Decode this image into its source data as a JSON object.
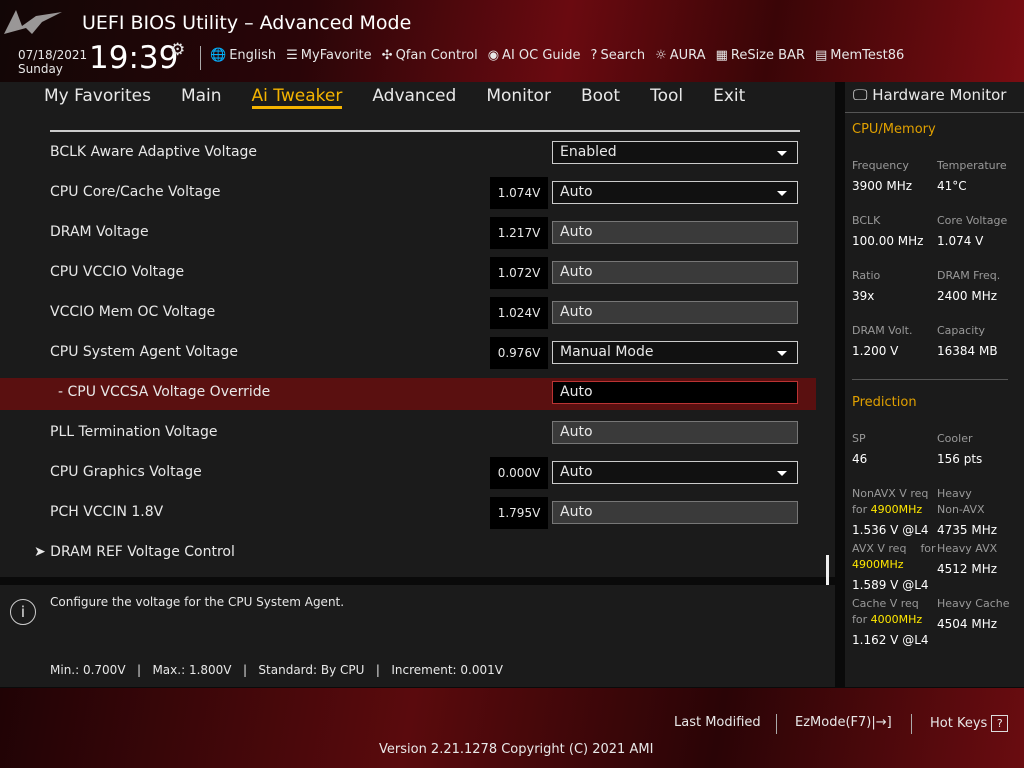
{
  "header": {
    "title": "UEFI BIOS Utility – Advanced Mode",
    "date": "07/18/2021",
    "day": "Sunday",
    "time": "19:39",
    "tools": [
      {
        "icon": "globe-icon",
        "glyph": "🌐",
        "label": "English"
      },
      {
        "icon": "favorite-icon",
        "glyph": "☰",
        "label": "MyFavorite"
      },
      {
        "icon": "fan-icon",
        "glyph": "✣",
        "label": "Qfan Control"
      },
      {
        "icon": "ai-oc-icon",
        "glyph": "◉",
        "label": "AI OC Guide"
      },
      {
        "icon": "help-icon",
        "glyph": "?",
        "label": "Search"
      },
      {
        "icon": "aura-icon",
        "glyph": "☼",
        "label": "AURA"
      },
      {
        "icon": "resize-bar-icon",
        "glyph": "▦",
        "label": "ReSize BAR"
      },
      {
        "icon": "memtest-icon",
        "glyph": "▤",
        "label": "MemTest86"
      }
    ]
  },
  "nav": {
    "tabs": [
      "My Favorites",
      "Main",
      "Ai Tweaker",
      "Advanced",
      "Monitor",
      "Boot",
      "Tool",
      "Exit"
    ],
    "active": "Ai Tweaker"
  },
  "settings": [
    {
      "label": "BCLK Aware Adaptive Voltage",
      "voltage": null,
      "value": "Enabled",
      "type": "dropdown"
    },
    {
      "label": "CPU Core/Cache Voltage",
      "voltage": "1.074V",
      "value": "Auto",
      "type": "dropdown"
    },
    {
      "label": "DRAM Voltage",
      "voltage": "1.217V",
      "value": "Auto",
      "type": "input"
    },
    {
      "label": "CPU VCCIO Voltage",
      "voltage": "1.072V",
      "value": "Auto",
      "type": "input"
    },
    {
      "label": "VCCIO Mem OC Voltage",
      "voltage": "1.024V",
      "value": "Auto",
      "type": "input"
    },
    {
      "label": "CPU System Agent Voltage",
      "voltage": "0.976V",
      "value": "Manual Mode",
      "type": "dropdown"
    },
    {
      "label": "- CPU VCCSA Voltage Override",
      "voltage": null,
      "value": "Auto",
      "type": "selected"
    },
    {
      "label": "PLL Termination Voltage",
      "voltage": null,
      "value": "Auto",
      "type": "input"
    },
    {
      "label": "CPU Graphics Voltage",
      "voltage": "0.000V",
      "value": "Auto",
      "type": "dropdown"
    },
    {
      "label": "PCH VCCIN 1.8V",
      "voltage": "1.795V",
      "value": "Auto",
      "type": "input"
    },
    {
      "label": "➤  DRAM REF Voltage Control",
      "voltage": null,
      "value": null,
      "type": "submenu"
    }
  ],
  "help": {
    "text": "Configure the voltage for the CPU System Agent.",
    "limits": "Min.: 0.700V   |   Max.: 1.800V   |   Standard: By CPU   |   Increment: 0.001V"
  },
  "hardware_monitor": {
    "title": "Hardware Monitor",
    "cpu_memory": {
      "title": "CPU/Memory",
      "items": [
        {
          "k": "Frequency",
          "v": "3900 MHz"
        },
        {
          "k": "Temperature",
          "v": "41°C"
        },
        {
          "k": "BCLK",
          "v": "100.00 MHz"
        },
        {
          "k": "Core Voltage",
          "v": "1.074 V"
        },
        {
          "k": "Ratio",
          "v": "39x"
        },
        {
          "k": "DRAM Freq.",
          "v": "2400 MHz"
        },
        {
          "k": "DRAM Volt.",
          "v": "1.200 V"
        },
        {
          "k": "Capacity",
          "v": "16384 MB"
        }
      ]
    },
    "prediction": {
      "title": "Prediction",
      "sp_label": "SP",
      "sp": "46",
      "cooler_label": "Cooler",
      "cooler": "156 pts",
      "nonavx_req": "NonAVX V req",
      "nonavx_for": "for ",
      "nonavx_freq": "4900MHz",
      "nonavx_v": "1.536 V @L4",
      "heavy_nonavx_label1": "Heavy",
      "heavy_nonavx_label2": "Non-AVX",
      "heavy_nonavx": "4735 MHz",
      "avx_req": "AVX V req",
      "avx_for": "for",
      "avx_freq": "4900MHz",
      "avx_v": "1.589 V @L4",
      "heavy_avx_label": "Heavy AVX",
      "heavy_avx": "4512 MHz",
      "cache_req": "Cache V req",
      "cache_for": "for ",
      "cache_freq": "4000MHz",
      "cache_v": "1.162 V @L4",
      "heavy_cache_label": "Heavy Cache",
      "heavy_cache": "4504 MHz"
    }
  },
  "footer": {
    "last_modified": "Last Modified",
    "ezmode": "EzMode(F7)|",
    "hotkeys": "Hot Keys",
    "version": "Version 2.21.1278 Copyright (C) 2021 AMI"
  }
}
